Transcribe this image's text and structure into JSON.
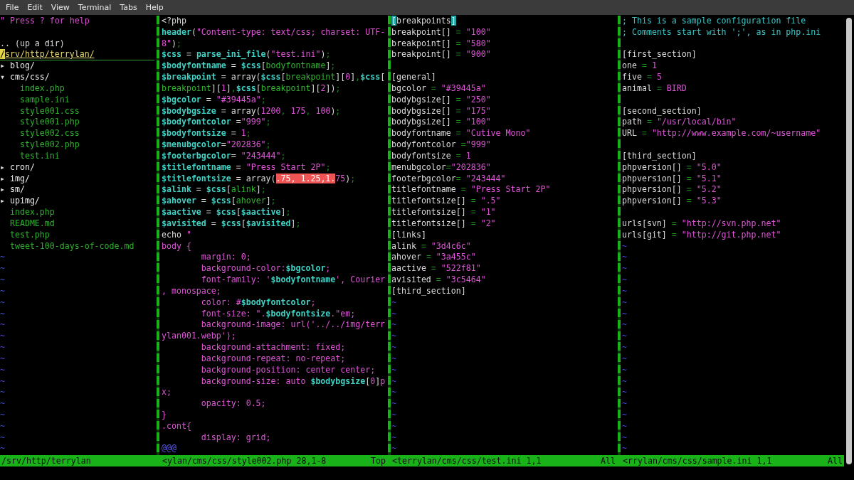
{
  "menu": [
    {
      "label": "File"
    },
    {
      "label": "Edit"
    },
    {
      "label": "View"
    },
    {
      "label": "Terminal"
    },
    {
      "label": "Tabs"
    },
    {
      "label": "Help"
    }
  ],
  "panes": [
    {
      "kind": "tree",
      "lines": [
        {
          "kind": "code",
          "segments": [
            {
              "kind": "help",
              "text": "\" Press ? for help"
            }
          ]
        },
        {
          "kind": "blank"
        },
        {
          "kind": "code",
          "segments": [
            {
              "kind": "plain",
              "text": ".. (up a dir)"
            }
          ]
        },
        {
          "kind": "cursorline",
          "segments": [
            {
              "kind": "cursor",
              "text": "/"
            },
            {
              "kind": "curtext",
              "text": "srv/http/terrylan/"
            }
          ]
        },
        {
          "kind": "code",
          "segments": [
            {
              "kind": "plain",
              "text": "▸ "
            },
            {
              "kind": "dir",
              "text": "blog/"
            }
          ]
        },
        {
          "kind": "code",
          "segments": [
            {
              "kind": "plain",
              "text": "▾ "
            },
            {
              "kind": "dir",
              "text": "cms/css/"
            }
          ]
        },
        {
          "kind": "code",
          "segments": [
            {
              "kind": "file",
              "text": "    index.php"
            }
          ]
        },
        {
          "kind": "code",
          "segments": [
            {
              "kind": "file",
              "text": "    sample.ini"
            }
          ]
        },
        {
          "kind": "code",
          "segments": [
            {
              "kind": "file",
              "text": "    style001.css"
            }
          ]
        },
        {
          "kind": "code",
          "segments": [
            {
              "kind": "file",
              "text": "    style001.php"
            }
          ]
        },
        {
          "kind": "code",
          "segments": [
            {
              "kind": "file",
              "text": "    style002.css"
            }
          ]
        },
        {
          "kind": "code",
          "segments": [
            {
              "kind": "file",
              "text": "    style002.php"
            }
          ]
        },
        {
          "kind": "code",
          "segments": [
            {
              "kind": "file",
              "text": "    test.ini"
            }
          ]
        },
        {
          "kind": "code",
          "segments": [
            {
              "kind": "plain",
              "text": "▸ "
            },
            {
              "kind": "dir",
              "text": "cron/"
            }
          ]
        },
        {
          "kind": "code",
          "segments": [
            {
              "kind": "plain",
              "text": "▸ "
            },
            {
              "kind": "dir",
              "text": "img/"
            }
          ]
        },
        {
          "kind": "code",
          "segments": [
            {
              "kind": "plain",
              "text": "▸ "
            },
            {
              "kind": "dir",
              "text": "sm/"
            }
          ]
        },
        {
          "kind": "code",
          "segments": [
            {
              "kind": "plain",
              "text": "▸ "
            },
            {
              "kind": "dir",
              "text": "upimg/"
            }
          ]
        },
        {
          "kind": "code",
          "segments": [
            {
              "kind": "file",
              "text": "  index.php"
            }
          ]
        },
        {
          "kind": "code",
          "segments": [
            {
              "kind": "file",
              "text": "  README.md"
            }
          ]
        },
        {
          "kind": "code",
          "segments": [
            {
              "kind": "file",
              "text": "  test.php"
            }
          ]
        },
        {
          "kind": "code",
          "segments": [
            {
              "kind": "file",
              "text": "  tweet-100-days-of-code.md"
            }
          ]
        },
        {
          "kind": "tilde",
          "text": "~"
        },
        {
          "kind": "tilde",
          "text": "~"
        },
        {
          "kind": "tilde",
          "text": "~"
        },
        {
          "kind": "tilde",
          "text": "~"
        },
        {
          "kind": "tilde",
          "text": "~"
        },
        {
          "kind": "tilde",
          "text": "~"
        },
        {
          "kind": "tilde",
          "text": "~"
        },
        {
          "kind": "tilde",
          "text": "~"
        },
        {
          "kind": "tilde",
          "text": "~"
        },
        {
          "kind": "tilde",
          "text": "~"
        },
        {
          "kind": "tilde",
          "text": "~"
        },
        {
          "kind": "tilde",
          "text": "~"
        },
        {
          "kind": "tilde",
          "text": "~"
        },
        {
          "kind": "tilde",
          "text": "~"
        },
        {
          "kind": "tilde",
          "text": "~"
        },
        {
          "kind": "tilde",
          "text": "~"
        },
        {
          "kind": "tilde",
          "text": "~"
        },
        {
          "kind": "tilde",
          "text": "~"
        }
      ],
      "status": {
        "text": "/srv/http/terrylan"
      }
    },
    {
      "kind": "editor",
      "lines": [
        {
          "kind": "code",
          "segments": [
            {
              "kind": "plain",
              "text": "<?php"
            }
          ]
        },
        {
          "kind": "code",
          "segments": [
            {
              "kind": "var",
              "text": "header"
            },
            {
              "kind": "plain",
              "text": "("
            },
            {
              "kind": "str",
              "text": "\"Content-type: text/css; charset: UTF-"
            }
          ]
        },
        {
          "kind": "code",
          "segments": [
            {
              "kind": "str",
              "text": "8\""
            },
            {
              "kind": "plain",
              "text": ")"
            },
            {
              "kind": "punct",
              "text": ";"
            }
          ]
        },
        {
          "kind": "code",
          "segments": [
            {
              "kind": "var",
              "text": "$css"
            },
            {
              "kind": "plain",
              "text": " = "
            },
            {
              "kind": "var",
              "text": "parse_ini_file"
            },
            {
              "kind": "plain",
              "text": "("
            },
            {
              "kind": "str",
              "text": "\"test.ini\""
            },
            {
              "kind": "plain",
              "text": ")"
            },
            {
              "kind": "punct",
              "text": ";"
            }
          ]
        },
        {
          "kind": "code",
          "segments": [
            {
              "kind": "var",
              "text": "$bodyfontname"
            },
            {
              "kind": "plain",
              "text": " = "
            },
            {
              "kind": "var",
              "text": "$css"
            },
            {
              "kind": "plain",
              "text": "["
            },
            {
              "kind": "key",
              "text": "bodyfontname"
            },
            {
              "kind": "plain",
              "text": "]"
            },
            {
              "kind": "punct",
              "text": ";"
            }
          ]
        },
        {
          "kind": "code",
          "segments": [
            {
              "kind": "var",
              "text": "$breakpoint"
            },
            {
              "kind": "plain",
              "text": " = array("
            },
            {
              "kind": "var",
              "text": "$css"
            },
            {
              "kind": "plain",
              "text": "["
            },
            {
              "kind": "key",
              "text": "breakpoint"
            },
            {
              "kind": "plain",
              "text": "]["
            },
            {
              "kind": "num",
              "text": "0"
            },
            {
              "kind": "plain",
              "text": "]"
            },
            {
              "kind": "punct",
              "text": ","
            },
            {
              "kind": "var",
              "text": "$css"
            },
            {
              "kind": "plain",
              "text": "["
            }
          ]
        },
        {
          "kind": "code",
          "segments": [
            {
              "kind": "key",
              "text": "breakpoint"
            },
            {
              "kind": "plain",
              "text": "]["
            },
            {
              "kind": "num",
              "text": "1"
            },
            {
              "kind": "plain",
              "text": "]"
            },
            {
              "kind": "punct",
              "text": ","
            },
            {
              "kind": "var",
              "text": "$css"
            },
            {
              "kind": "plain",
              "text": "["
            },
            {
              "kind": "key",
              "text": "breakpoint"
            },
            {
              "kind": "plain",
              "text": "]["
            },
            {
              "kind": "num",
              "text": "2"
            },
            {
              "kind": "plain",
              "text": "])"
            },
            {
              "kind": "punct",
              "text": ";"
            }
          ]
        },
        {
          "kind": "code",
          "segments": [
            {
              "kind": "var",
              "text": "$bgcolor"
            },
            {
              "kind": "plain",
              "text": " = "
            },
            {
              "kind": "str",
              "text": "\"#39445a\""
            },
            {
              "kind": "punct",
              "text": ";"
            }
          ]
        },
        {
          "kind": "code",
          "segments": [
            {
              "kind": "var",
              "text": "$bodybgsize"
            },
            {
              "kind": "plain",
              "text": " = array("
            },
            {
              "kind": "num",
              "text": "1200"
            },
            {
              "kind": "punct",
              "text": ", "
            },
            {
              "kind": "num",
              "text": "175"
            },
            {
              "kind": "punct",
              "text": ", "
            },
            {
              "kind": "num",
              "text": "100"
            },
            {
              "kind": "plain",
              "text": ")"
            },
            {
              "kind": "punct",
              "text": ";"
            }
          ]
        },
        {
          "kind": "code",
          "segments": [
            {
              "kind": "var",
              "text": "$bodyfontcolor"
            },
            {
              "kind": "plain",
              "text": " ="
            },
            {
              "kind": "str",
              "text": "\"999\""
            },
            {
              "kind": "punct",
              "text": ";"
            }
          ]
        },
        {
          "kind": "code",
          "segments": [
            {
              "kind": "var",
              "text": "$bodyfontsize"
            },
            {
              "kind": "plain",
              "text": " = "
            },
            {
              "kind": "num",
              "text": "1"
            },
            {
              "kind": "punct",
              "text": ";"
            }
          ]
        },
        {
          "kind": "code",
          "segments": [
            {
              "kind": "var",
              "text": "$menubgcolor"
            },
            {
              "kind": "plain",
              "text": "="
            },
            {
              "kind": "str",
              "text": "\"202836\""
            },
            {
              "kind": "punct",
              "text": ";"
            }
          ]
        },
        {
          "kind": "code",
          "segments": [
            {
              "kind": "var",
              "text": "$footerbgcolor"
            },
            {
              "kind": "plain",
              "text": "= "
            },
            {
              "kind": "str",
              "text": "\"243444\""
            },
            {
              "kind": "punct",
              "text": ";"
            }
          ]
        },
        {
          "kind": "code",
          "segments": [
            {
              "kind": "var",
              "text": "$titlefontname"
            },
            {
              "kind": "plain",
              "text": " = "
            },
            {
              "kind": "str",
              "text": "\"Press Start 2P\""
            },
            {
              "kind": "punct",
              "text": ";"
            }
          ]
        },
        {
          "kind": "code",
          "segments": [
            {
              "kind": "var",
              "text": "$titlefontsize"
            },
            {
              "kind": "plain",
              "text": " = array("
            },
            {
              "kind": "hl",
              "text": ".75, 1.25,1."
            },
            {
              "kind": "num",
              "text": "75"
            },
            {
              "kind": "plain",
              "text": ")"
            },
            {
              "kind": "punct",
              "text": ";"
            }
          ]
        },
        {
          "kind": "code",
          "segments": [
            {
              "kind": "var",
              "text": "$alink"
            },
            {
              "kind": "plain",
              "text": " = "
            },
            {
              "kind": "var",
              "text": "$css"
            },
            {
              "kind": "plain",
              "text": "["
            },
            {
              "kind": "key",
              "text": "alink"
            },
            {
              "kind": "plain",
              "text": "]"
            },
            {
              "kind": "punct",
              "text": ";"
            }
          ]
        },
        {
          "kind": "code",
          "segments": [
            {
              "kind": "var",
              "text": "$ahover"
            },
            {
              "kind": "plain",
              "text": " = "
            },
            {
              "kind": "var",
              "text": "$css"
            },
            {
              "kind": "plain",
              "text": "["
            },
            {
              "kind": "key",
              "text": "ahover"
            },
            {
              "kind": "plain",
              "text": "]"
            },
            {
              "kind": "punct",
              "text": ";"
            }
          ]
        },
        {
          "kind": "code",
          "segments": [
            {
              "kind": "var",
              "text": "$aactive"
            },
            {
              "kind": "plain",
              "text": " = "
            },
            {
              "kind": "var",
              "text": "$css"
            },
            {
              "kind": "plain",
              "text": "["
            },
            {
              "kind": "var",
              "text": "$aactive"
            },
            {
              "kind": "plain",
              "text": "]"
            },
            {
              "kind": "punct",
              "text": ";"
            }
          ]
        },
        {
          "kind": "code",
          "segments": [
            {
              "kind": "var",
              "text": "$avisited"
            },
            {
              "kind": "plain",
              "text": " = "
            },
            {
              "kind": "var",
              "text": "$css"
            },
            {
              "kind": "plain",
              "text": "["
            },
            {
              "kind": "var",
              "text": "$avisited"
            },
            {
              "kind": "plain",
              "text": "]"
            },
            {
              "kind": "punct",
              "text": ";"
            }
          ]
        },
        {
          "kind": "code",
          "segments": [
            {
              "kind": "plain",
              "text": "echo "
            },
            {
              "kind": "str",
              "text": "\""
            }
          ]
        },
        {
          "kind": "code",
          "segments": [
            {
              "kind": "str",
              "text": "body {"
            }
          ]
        },
        {
          "kind": "code",
          "segments": [
            {
              "kind": "str",
              "text": "        margin: 0;"
            }
          ]
        },
        {
          "kind": "code",
          "segments": [
            {
              "kind": "str",
              "text": "        background-color:"
            },
            {
              "kind": "var",
              "text": "$bgcolor"
            },
            {
              "kind": "str",
              "text": ";"
            }
          ]
        },
        {
          "kind": "code",
          "segments": [
            {
              "kind": "str",
              "text": "        font-family: '"
            },
            {
              "kind": "var",
              "text": "$bodyfontname"
            },
            {
              "kind": "str",
              "text": "', Courier"
            }
          ]
        },
        {
          "kind": "code",
          "segments": [
            {
              "kind": "str",
              "text": ", monospace;"
            }
          ]
        },
        {
          "kind": "code",
          "segments": [
            {
              "kind": "str",
              "text": "        color: #"
            },
            {
              "kind": "var",
              "text": "$bodyfontcolor"
            },
            {
              "kind": "str",
              "text": ";"
            }
          ]
        },
        {
          "kind": "code",
          "segments": [
            {
              "kind": "str",
              "text": "        font-size: \"."
            },
            {
              "kind": "var",
              "text": "$bodyfontsize"
            },
            {
              "kind": "str",
              "text": ".\"em;"
            }
          ]
        },
        {
          "kind": "code",
          "segments": [
            {
              "kind": "str",
              "text": "        background-image: url('../../img/terr"
            }
          ]
        },
        {
          "kind": "code",
          "segments": [
            {
              "kind": "str",
              "text": "ylan001.webp');"
            }
          ]
        },
        {
          "kind": "code",
          "segments": [
            {
              "kind": "str",
              "text": "        background-attachment: fixed;"
            }
          ]
        },
        {
          "kind": "code",
          "segments": [
            {
              "kind": "str",
              "text": "        background-repeat: no-repeat;"
            }
          ]
        },
        {
          "kind": "code",
          "segments": [
            {
              "kind": "str",
              "text": "        background-position: center center;"
            }
          ]
        },
        {
          "kind": "code",
          "segments": [
            {
              "kind": "str",
              "text": "        background-size: auto "
            },
            {
              "kind": "var",
              "text": "$bodybgsize"
            },
            {
              "kind": "plain",
              "text": "["
            },
            {
              "kind": "num",
              "text": "0"
            },
            {
              "kind": "plain",
              "text": "]"
            },
            {
              "kind": "str",
              "text": "p"
            }
          ]
        },
        {
          "kind": "code",
          "segments": [
            {
              "kind": "str",
              "text": "x;"
            }
          ]
        },
        {
          "kind": "code",
          "segments": [
            {
              "kind": "str",
              "text": "        opacity: 0.5;"
            }
          ]
        },
        {
          "kind": "code",
          "segments": [
            {
              "kind": "str",
              "text": "}"
            }
          ]
        },
        {
          "kind": "code",
          "segments": [
            {
              "kind": "str",
              "text": ".cont{"
            }
          ]
        },
        {
          "kind": "code",
          "segments": [
            {
              "kind": "str",
              "text": "        display: grid;"
            }
          ]
        },
        {
          "kind": "code",
          "segments": [
            {
              "kind": "nontext",
              "text": "@@@"
            }
          ]
        }
      ],
      "status": {
        "text": "<ylan/cms/css/style002.php 28,1-8",
        "position": "Top"
      }
    },
    {
      "kind": "editor",
      "lines": [
        {
          "kind": "code",
          "segments": [
            {
              "kind": "match",
              "text": "["
            },
            {
              "kind": "plain",
              "text": "breakpoints"
            },
            {
              "kind": "match",
              "text": "]"
            }
          ]
        },
        {
          "kind": "code",
          "segments": [
            {
              "kind": "plain",
              "text": "breakpoint[] "
            },
            {
              "kind": "punct",
              "text": "= "
            },
            {
              "kind": "str",
              "text": "\"100\""
            }
          ]
        },
        {
          "kind": "code",
          "segments": [
            {
              "kind": "plain",
              "text": "breakpoint[] "
            },
            {
              "kind": "punct",
              "text": "= "
            },
            {
              "kind": "str",
              "text": "\"580\""
            }
          ]
        },
        {
          "kind": "code",
          "segments": [
            {
              "kind": "plain",
              "text": "breakpoint[] "
            },
            {
              "kind": "punct",
              "text": "= "
            },
            {
              "kind": "str",
              "text": "\"900\""
            }
          ]
        },
        {
          "kind": "blank"
        },
        {
          "kind": "code",
          "segments": [
            {
              "kind": "plain",
              "text": "[general]"
            }
          ]
        },
        {
          "kind": "code",
          "segments": [
            {
              "kind": "plain",
              "text": "bgcolor "
            },
            {
              "kind": "punct",
              "text": "= "
            },
            {
              "kind": "str",
              "text": "\"#39445a\""
            }
          ]
        },
        {
          "kind": "code",
          "segments": [
            {
              "kind": "plain",
              "text": "bodybgsize[] "
            },
            {
              "kind": "punct",
              "text": "= "
            },
            {
              "kind": "str",
              "text": "\"250\""
            }
          ]
        },
        {
          "kind": "code",
          "segments": [
            {
              "kind": "plain",
              "text": "bodybgsize[] "
            },
            {
              "kind": "punct",
              "text": "= "
            },
            {
              "kind": "str",
              "text": "\"175\""
            }
          ]
        },
        {
          "kind": "code",
          "segments": [
            {
              "kind": "plain",
              "text": "bodybgsize[] "
            },
            {
              "kind": "punct",
              "text": "= "
            },
            {
              "kind": "str",
              "text": "\"100\""
            }
          ]
        },
        {
          "kind": "code",
          "segments": [
            {
              "kind": "plain",
              "text": "bodyfontname "
            },
            {
              "kind": "punct",
              "text": "= "
            },
            {
              "kind": "str",
              "text": "\"Cutive Mono\""
            }
          ]
        },
        {
          "kind": "code",
          "segments": [
            {
              "kind": "plain",
              "text": "bodyfontcolor "
            },
            {
              "kind": "punct",
              "text": "="
            },
            {
              "kind": "str",
              "text": "\"999\""
            }
          ]
        },
        {
          "kind": "code",
          "segments": [
            {
              "kind": "plain",
              "text": "bodyfontsize "
            },
            {
              "kind": "punct",
              "text": "= "
            },
            {
              "kind": "num",
              "text": "1"
            }
          ]
        },
        {
          "kind": "code",
          "segments": [
            {
              "kind": "plain",
              "text": "menubgcolor"
            },
            {
              "kind": "punct",
              "text": "="
            },
            {
              "kind": "str",
              "text": "\"202836\""
            }
          ]
        },
        {
          "kind": "code",
          "segments": [
            {
              "kind": "plain",
              "text": "footerbgcolor"
            },
            {
              "kind": "punct",
              "text": "= "
            },
            {
              "kind": "str",
              "text": "\"243444\""
            }
          ]
        },
        {
          "kind": "code",
          "segments": [
            {
              "kind": "plain",
              "text": "titlefontname "
            },
            {
              "kind": "punct",
              "text": "= "
            },
            {
              "kind": "str",
              "text": "\"Press Start 2P\""
            }
          ]
        },
        {
          "kind": "code",
          "segments": [
            {
              "kind": "plain",
              "text": "titlefontsize[] "
            },
            {
              "kind": "punct",
              "text": "= "
            },
            {
              "kind": "str",
              "text": "\".5\""
            }
          ]
        },
        {
          "kind": "code",
          "segments": [
            {
              "kind": "plain",
              "text": "titlefontsize[] "
            },
            {
              "kind": "punct",
              "text": "= "
            },
            {
              "kind": "str",
              "text": "\"1\""
            }
          ]
        },
        {
          "kind": "code",
          "segments": [
            {
              "kind": "plain",
              "text": "titlefontsize[] "
            },
            {
              "kind": "punct",
              "text": "= "
            },
            {
              "kind": "str",
              "text": "\"2\""
            }
          ]
        },
        {
          "kind": "code",
          "segments": [
            {
              "kind": "plain",
              "text": "[links]"
            }
          ]
        },
        {
          "kind": "code",
          "segments": [
            {
              "kind": "plain",
              "text": "alink "
            },
            {
              "kind": "punct",
              "text": "= "
            },
            {
              "kind": "str",
              "text": "\"3d4c6c\""
            }
          ]
        },
        {
          "kind": "code",
          "segments": [
            {
              "kind": "plain",
              "text": "ahover "
            },
            {
              "kind": "punct",
              "text": "= "
            },
            {
              "kind": "str",
              "text": "\"3a455c\""
            }
          ]
        },
        {
          "kind": "code",
          "segments": [
            {
              "kind": "plain",
              "text": "aactive "
            },
            {
              "kind": "punct",
              "text": "= "
            },
            {
              "kind": "str",
              "text": "\"522f81\""
            }
          ]
        },
        {
          "kind": "code",
          "segments": [
            {
              "kind": "plain",
              "text": "avisited "
            },
            {
              "kind": "punct",
              "text": "= "
            },
            {
              "kind": "str",
              "text": "\"3c5464\""
            }
          ]
        },
        {
          "kind": "code",
          "segments": [
            {
              "kind": "plain",
              "text": "[third_section]"
            }
          ]
        },
        {
          "kind": "tilde",
          "text": "~"
        },
        {
          "kind": "tilde",
          "text": "~"
        },
        {
          "kind": "tilde",
          "text": "~"
        },
        {
          "kind": "tilde",
          "text": "~"
        },
        {
          "kind": "tilde",
          "text": "~"
        },
        {
          "kind": "tilde",
          "text": "~"
        },
        {
          "kind": "tilde",
          "text": "~"
        },
        {
          "kind": "tilde",
          "text": "~"
        },
        {
          "kind": "tilde",
          "text": "~"
        },
        {
          "kind": "tilde",
          "text": "~"
        },
        {
          "kind": "tilde",
          "text": "~"
        },
        {
          "kind": "tilde",
          "text": "~"
        },
        {
          "kind": "tilde",
          "text": "~"
        },
        {
          "kind": "tilde",
          "text": "~"
        }
      ],
      "status": {
        "text": "<terrylan/cms/css/test.ini 1,1",
        "position": "All"
      }
    },
    {
      "kind": "editor",
      "lines": [
        {
          "kind": "code",
          "segments": [
            {
              "kind": "comment",
              "text": "; This is a sample configuration file"
            }
          ]
        },
        {
          "kind": "code",
          "segments": [
            {
              "kind": "comment",
              "text": "; Comments start with ';', as in php.ini"
            }
          ]
        },
        {
          "kind": "blank"
        },
        {
          "kind": "code",
          "segments": [
            {
              "kind": "plain",
              "text": "[first_section]"
            }
          ]
        },
        {
          "kind": "code",
          "segments": [
            {
              "kind": "plain",
              "text": "one "
            },
            {
              "kind": "punct",
              "text": "= "
            },
            {
              "kind": "num",
              "text": "1"
            }
          ]
        },
        {
          "kind": "code",
          "segments": [
            {
              "kind": "plain",
              "text": "five "
            },
            {
              "kind": "punct",
              "text": "= "
            },
            {
              "kind": "num",
              "text": "5"
            }
          ]
        },
        {
          "kind": "code",
          "segments": [
            {
              "kind": "plain",
              "text": "animal "
            },
            {
              "kind": "punct",
              "text": "= "
            },
            {
              "kind": "str",
              "text": "BIRD"
            }
          ]
        },
        {
          "kind": "blank"
        },
        {
          "kind": "code",
          "segments": [
            {
              "kind": "plain",
              "text": "[second_section]"
            }
          ]
        },
        {
          "kind": "code",
          "segments": [
            {
              "kind": "plain",
              "text": "path "
            },
            {
              "kind": "punct",
              "text": "= "
            },
            {
              "kind": "str",
              "text": "\"/usr/local/bin\""
            }
          ]
        },
        {
          "kind": "code",
          "segments": [
            {
              "kind": "plain",
              "text": "URL "
            },
            {
              "kind": "punct",
              "text": "= "
            },
            {
              "kind": "str",
              "text": "\"http://www.example.com/~username\""
            }
          ]
        },
        {
          "kind": "blank"
        },
        {
          "kind": "code",
          "segments": [
            {
              "kind": "plain",
              "text": "[third_section]"
            }
          ]
        },
        {
          "kind": "code",
          "segments": [
            {
              "kind": "plain",
              "text": "phpversion[] "
            },
            {
              "kind": "punct",
              "text": "= "
            },
            {
              "kind": "str",
              "text": "\"5.0\""
            }
          ]
        },
        {
          "kind": "code",
          "segments": [
            {
              "kind": "plain",
              "text": "phpversion[] "
            },
            {
              "kind": "punct",
              "text": "= "
            },
            {
              "kind": "str",
              "text": "\"5.1\""
            }
          ]
        },
        {
          "kind": "code",
          "segments": [
            {
              "kind": "plain",
              "text": "phpversion[] "
            },
            {
              "kind": "punct",
              "text": "= "
            },
            {
              "kind": "str",
              "text": "\"5.2\""
            }
          ]
        },
        {
          "kind": "code",
          "segments": [
            {
              "kind": "plain",
              "text": "phpversion[] "
            },
            {
              "kind": "punct",
              "text": "= "
            },
            {
              "kind": "str",
              "text": "\"5.3\""
            }
          ]
        },
        {
          "kind": "blank"
        },
        {
          "kind": "code",
          "segments": [
            {
              "kind": "plain",
              "text": "urls[svn] "
            },
            {
              "kind": "punct",
              "text": "= "
            },
            {
              "kind": "str",
              "text": "\"http://svn.php.net\""
            }
          ]
        },
        {
          "kind": "code",
          "segments": [
            {
              "kind": "plain",
              "text": "urls[git] "
            },
            {
              "kind": "punct",
              "text": "= "
            },
            {
              "kind": "str",
              "text": "\"http://git.php.net\""
            }
          ]
        },
        {
          "kind": "tilde",
          "text": "~"
        },
        {
          "kind": "tilde",
          "text": "~"
        },
        {
          "kind": "tilde",
          "text": "~"
        },
        {
          "kind": "tilde",
          "text": "~"
        },
        {
          "kind": "tilde",
          "text": "~"
        },
        {
          "kind": "tilde",
          "text": "~"
        },
        {
          "kind": "tilde",
          "text": "~"
        },
        {
          "kind": "tilde",
          "text": "~"
        },
        {
          "kind": "tilde",
          "text": "~"
        },
        {
          "kind": "tilde",
          "text": "~"
        },
        {
          "kind": "tilde",
          "text": "~"
        },
        {
          "kind": "tilde",
          "text": "~"
        },
        {
          "kind": "tilde",
          "text": "~"
        },
        {
          "kind": "tilde",
          "text": "~"
        },
        {
          "kind": "tilde",
          "text": "~"
        },
        {
          "kind": "tilde",
          "text": "~"
        },
        {
          "kind": "tilde",
          "text": "~"
        },
        {
          "kind": "tilde",
          "text": "~"
        },
        {
          "kind": "tilde",
          "text": "~"
        }
      ],
      "status": {
        "text": "<rrylan/cms/css/sample.ini 1,1",
        "position": "All"
      }
    }
  ]
}
